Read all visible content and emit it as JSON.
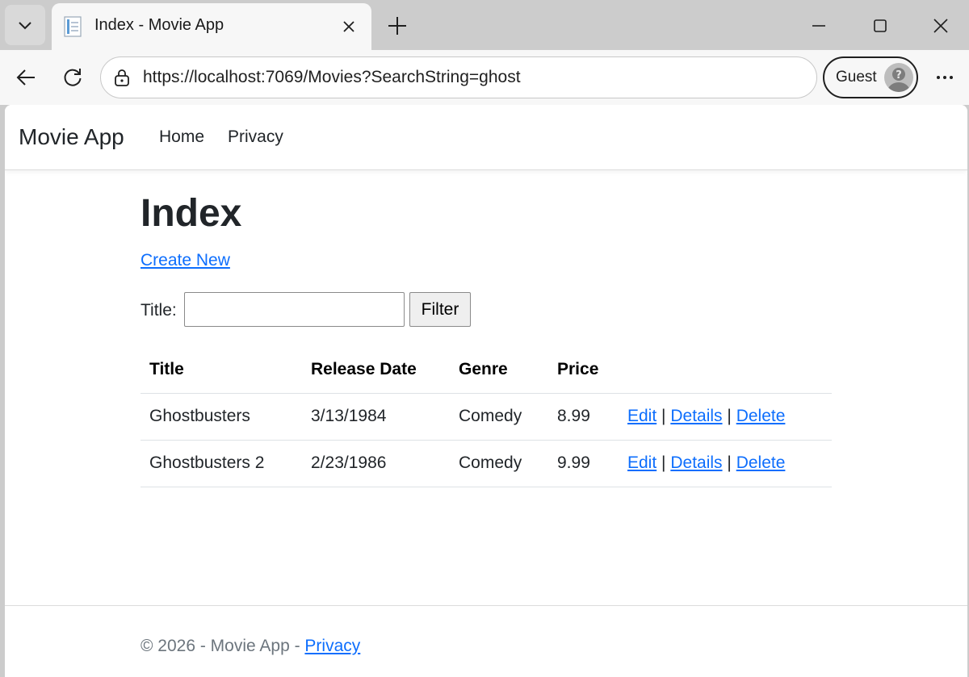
{
  "browser": {
    "tab_title": "Index - Movie App",
    "url": "https://localhost:7069/Movies?SearchString=ghost",
    "profile_label": "Guest"
  },
  "nav": {
    "brand": "Movie App",
    "links": [
      "Home",
      "Privacy"
    ]
  },
  "main": {
    "title": "Index",
    "create_link": "Create New",
    "filter": {
      "label": "Title:",
      "value": "",
      "button": "Filter"
    },
    "table": {
      "headers": [
        "Title",
        "Release Date",
        "Genre",
        "Price"
      ],
      "rows": [
        {
          "title": "Ghostbusters",
          "release_date": "3/13/1984",
          "genre": "Comedy",
          "price": "8.99"
        },
        {
          "title": "Ghostbusters 2",
          "release_date": "2/23/1986",
          "genre": "Comedy",
          "price": "9.99"
        }
      ],
      "actions": {
        "edit": "Edit",
        "details": "Details",
        "delete": "Delete",
        "separator": "|"
      }
    }
  },
  "footer": {
    "text": "© 2026 - Movie App - ",
    "link": "Privacy"
  },
  "colors": {
    "link": "#0d6efd",
    "text": "#212529",
    "muted": "#6c757d",
    "chrome": "#cccccc"
  }
}
